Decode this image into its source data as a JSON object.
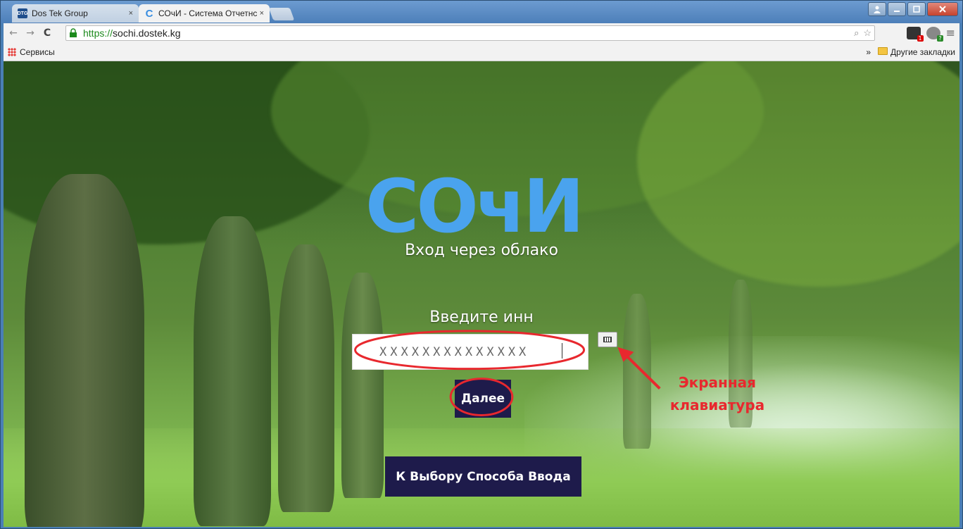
{
  "browser": {
    "tabs": [
      {
        "favicon": "DTG",
        "label": "Dos Tek Group",
        "close": "×",
        "active": false
      },
      {
        "favicon": "С",
        "label": "СОчИ - Система Отчетнс",
        "close": "×",
        "active": true
      }
    ],
    "url_scheme": "https://",
    "url_host": "sochi.dostek.kg",
    "bookmarks": {
      "apps_label": "Сервисы",
      "overflow": "»",
      "other_label": "Другие закладки"
    },
    "icons": {
      "back": "back-arrow-icon",
      "forward": "forward-arrow-icon",
      "reload": "reload-icon",
      "lock": "lock-icon",
      "zoom": "zoom-icon",
      "star": "bookmark-star-icon",
      "menu": "hamburger-menu-icon"
    },
    "extension_badges": [
      "1",
      "?"
    ]
  },
  "page": {
    "logo_text": "СОчИ",
    "subtitle": "Вход через облако",
    "prompt": "Введите инн",
    "inn_value": "XXXXXXXXXXXXXX",
    "next_button": "Далее",
    "back_button": "К Выбору Способа Ввода",
    "annotation_line1": "Экранная",
    "annotation_line2": "клавиатура"
  },
  "colors": {
    "logo_blue": "#4aa3ee",
    "button_bg": "#1e1b4b",
    "annotation_red": "#e8282e",
    "url_green": "#1d8a1d"
  }
}
